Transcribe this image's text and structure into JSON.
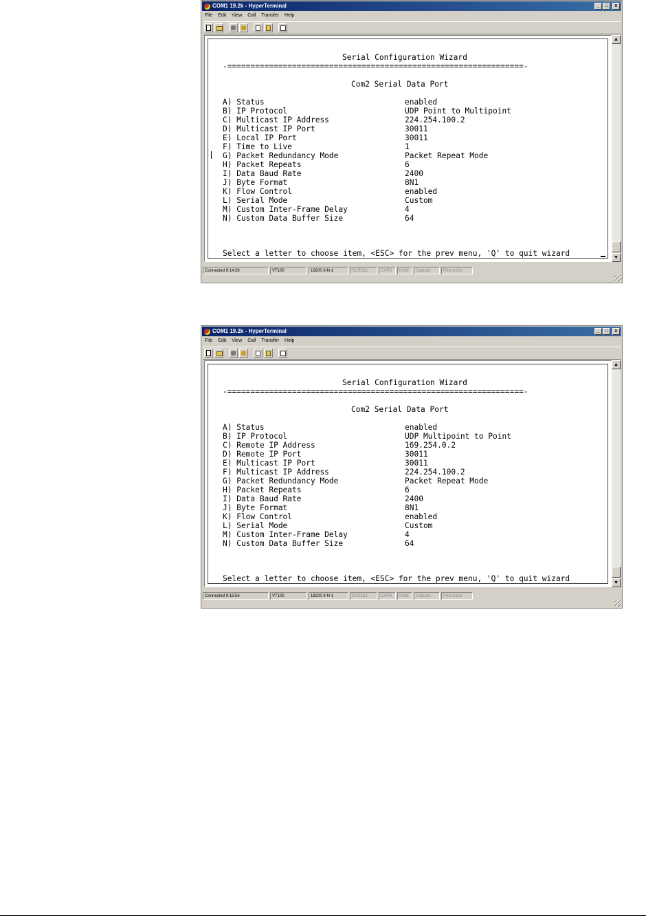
{
  "windows": [
    {
      "title": "COM1 19.2k - HyperTerminal",
      "controls": {
        "minimize": "_",
        "maximize": "□",
        "close": "x"
      },
      "menu": [
        "File",
        "Edit",
        "View",
        "Call",
        "Transfer",
        "Help"
      ],
      "toolbar_icons": [
        "new-icon",
        "open-icon",
        "dial-icon",
        "hangup-icon",
        "send-icon",
        "receive-icon",
        "properties-icon"
      ],
      "terminal": {
        "heading": "Serial Configuration Wizard",
        "rule": "-================================================================-",
        "subheading": "Com2 Serial Data Port",
        "items": [
          {
            "label": "A) Status",
            "value": "enabled"
          },
          {
            "label": "B) IP Protocol",
            "value": "UDP Point to Multipoint"
          },
          {
            "label": "C) Multicast IP Address",
            "value": "224.254.100.2"
          },
          {
            "label": "D) Multicast IP Port",
            "value": "30011"
          },
          {
            "label": "E) Local IP Port",
            "value": "30011"
          },
          {
            "label": "F) Time to Live",
            "value": "1"
          },
          {
            "label": "G) Packet Redundancy Mode",
            "value": "Packet Repeat Mode"
          },
          {
            "label": "H) Packet Repeats",
            "value": "6"
          },
          {
            "label": "I) Data Baud Rate",
            "value": "2400"
          },
          {
            "label": "J) Byte Format",
            "value": "8N1"
          },
          {
            "label": "K) Flow Control",
            "value": "enabled"
          },
          {
            "label": "L) Serial Mode",
            "value": "Custom"
          },
          {
            "label": "M) Custom Inter-Frame Delay",
            "value": "4"
          },
          {
            "label": "N) Custom Data Buffer Size",
            "value": "64"
          }
        ],
        "prompt": "Select a letter to choose item, <ESC> for the prev menu, 'Q' to quit wizard"
      },
      "status": [
        "Connected 0:14:38",
        "VT100",
        "19200 8-N-1",
        "SCROLL",
        "CAPS",
        "NUM",
        "Capture",
        "Print echo"
      ]
    },
    {
      "title": "COM1 19.2k - HyperTerminal",
      "controls": {
        "minimize": "_",
        "maximize": "□",
        "close": "x"
      },
      "menu": [
        "File",
        "Edit",
        "View",
        "Call",
        "Transfer",
        "Help"
      ],
      "toolbar_icons": [
        "new-icon",
        "open-icon",
        "dial-icon",
        "hangup-icon",
        "send-icon",
        "receive-icon",
        "properties-icon"
      ],
      "terminal": {
        "heading": "Serial Configuration Wizard",
        "rule": "-================================================================-",
        "subheading": "Com2 Serial Data Port",
        "items": [
          {
            "label": "A) Status",
            "value": "enabled"
          },
          {
            "label": "B) IP Protocol",
            "value": "UDP Multipoint to Point"
          },
          {
            "label": "C) Remote IP Address",
            "value": "169.254.0.2"
          },
          {
            "label": "D) Remote IP Port",
            "value": "30011"
          },
          {
            "label": "E) Multicast IP Port",
            "value": "30011"
          },
          {
            "label": "F) Multicast IP Address",
            "value": "224.254.100.2"
          },
          {
            "label": "G) Packet Redundancy Mode",
            "value": "Packet Repeat Mode"
          },
          {
            "label": "H) Packet Repeats",
            "value": "6"
          },
          {
            "label": "I) Data Baud Rate",
            "value": "2400"
          },
          {
            "label": "J) Byte Format",
            "value": "8N1"
          },
          {
            "label": "K) Flow Control",
            "value": "enabled"
          },
          {
            "label": "L) Serial Mode",
            "value": "Custom"
          },
          {
            "label": "M) Custom Inter-Frame Delay",
            "value": "4"
          },
          {
            "label": "N) Custom Data Buffer Size",
            "value": "64"
          }
        ],
        "prompt": "Select a letter to choose item, <ESC> for the prev menu, 'Q' to quit wizard"
      },
      "status": [
        "Connected 0:16:56",
        "VT100",
        "19200 8-N-1",
        "SCROLL",
        "CAPS",
        "NUM",
        "Capture",
        "Print echo"
      ]
    }
  ]
}
